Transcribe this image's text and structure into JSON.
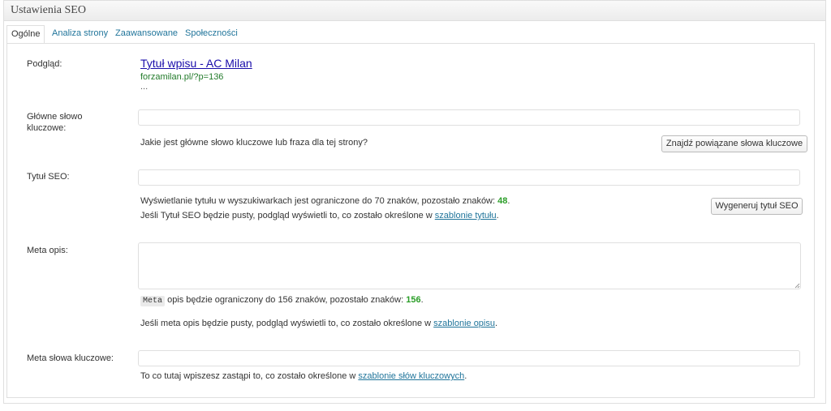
{
  "panel": {
    "title": "Ustawienia SEO"
  },
  "tabs": [
    {
      "label": "Ogólne"
    },
    {
      "label": "Analiza strony"
    },
    {
      "label": "Zaawansowane"
    },
    {
      "label": "Społeczności"
    }
  ],
  "preview": {
    "label": "Podgląd:",
    "title": "Tytuł wpisu - AC Milan",
    "url": "forzamilan.pl/?p=136",
    "description": "..."
  },
  "focus_keyword": {
    "label_line1": "Główne słowo",
    "label_line2": "kluczowe:",
    "value": "",
    "help": "Jakie jest główne słowo kluczowe lub fraza dla tej strony?",
    "button": "Znajdź powiązane słowa kluczowe"
  },
  "seo_title": {
    "label": "Tytuł SEO:",
    "value": "",
    "help1_prefix": "Wyświetlanie tytułu w wyszukiwarkach jest ograniczone do 70 znaków, pozostało znaków: ",
    "remaining": "48",
    "help1_suffix": ".",
    "help2_prefix": "Jeśli Tytuł SEO będzie pusty, podgląd wyświetli to, co zostało określone w ",
    "help2_link": "szablonie tytułu",
    "help2_suffix": ".",
    "button": "Wygeneruj tytuł SEO"
  },
  "meta_desc": {
    "label": "Meta opis:",
    "value": "",
    "code": "Meta",
    "help1_prefix": " opis będzie ograniczony do 156 znaków, pozostało znaków: ",
    "remaining": "156",
    "help1_suffix": ".",
    "help2_prefix": "Jeśli meta opis będzie pusty, podgląd wyświetli to, co zostało określone w ",
    "help2_link": "szablonie opisu",
    "help2_suffix": "."
  },
  "meta_keywords": {
    "label": "Meta słowa kluczowe:",
    "value": "",
    "help_prefix": "To co tutaj wpiszesz zastąpi to, co zostało określone w ",
    "help_link": "szablonie słów kluczowych",
    "help_suffix": "."
  }
}
